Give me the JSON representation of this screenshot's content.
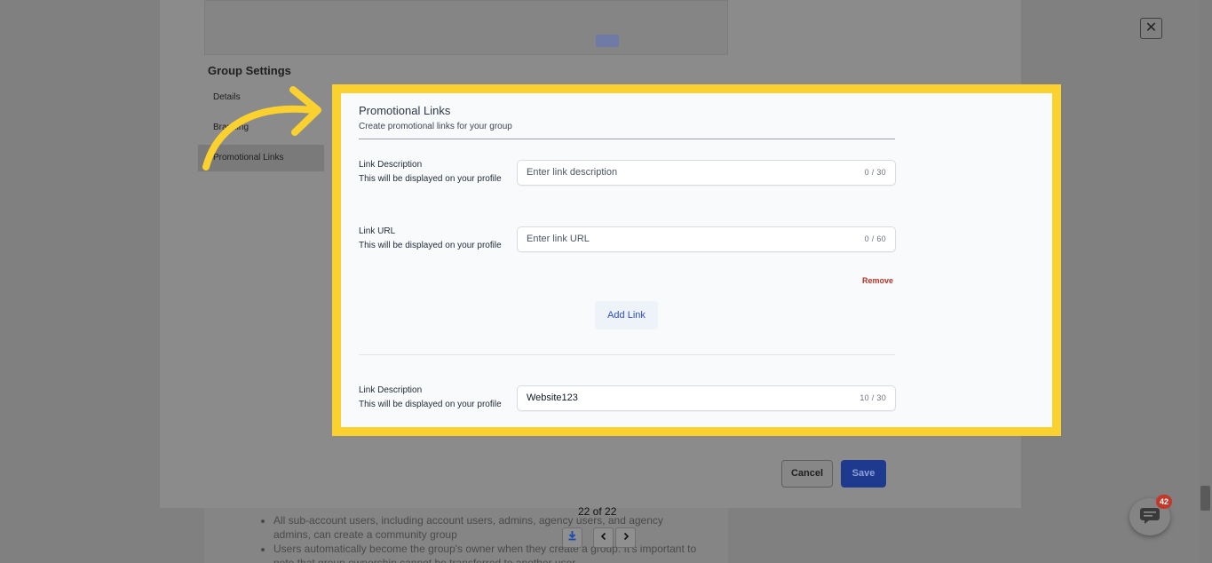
{
  "modal": {
    "close_label": "✕",
    "sidebar": {
      "title": "Group Settings",
      "items": [
        {
          "label": "Details"
        },
        {
          "label": "Branding"
        },
        {
          "label": "Promotional Links",
          "active": true
        }
      ]
    },
    "footer": {
      "cancel_label": "Cancel",
      "save_label": "Save"
    }
  },
  "promotional_links": {
    "title": "Promotional Links",
    "subtitle": "Create promotional links for your group",
    "fields": [
      {
        "label": "Link Description",
        "help": "This will be displayed on your profile",
        "value": "",
        "placeholder": "Enter link description",
        "counter": "0 / 30"
      },
      {
        "label": "Link URL",
        "help": "This will be displayed on your profile",
        "value": "",
        "placeholder": "Enter link URL",
        "counter": "0 / 60"
      },
      {
        "label": "Link Description",
        "help": "This will be displayed on your profile",
        "value": "Website123",
        "placeholder": "",
        "counter": "10 / 30"
      }
    ],
    "remove_label": "Remove",
    "add_link_label": "Add Link"
  },
  "doc_background": {
    "bullets": [
      "All sub-account users, including account users, admins, agency users, and agency admins, can create a community group",
      "Users automatically become the group's owner when they create a group. It's important to note that group ownership cannot be transferred to another user"
    ]
  },
  "pager": {
    "text": "22 of 22",
    "download_icon": "download-icon",
    "prev_icon": "chevron-left-icon",
    "next_icon": "chevron-right-icon"
  },
  "chat": {
    "badge": "42"
  },
  "colors": {
    "highlight": "#fbd12f",
    "primary": "#1e3a8f",
    "danger": "#b83227",
    "link": "#2d4fc9"
  }
}
